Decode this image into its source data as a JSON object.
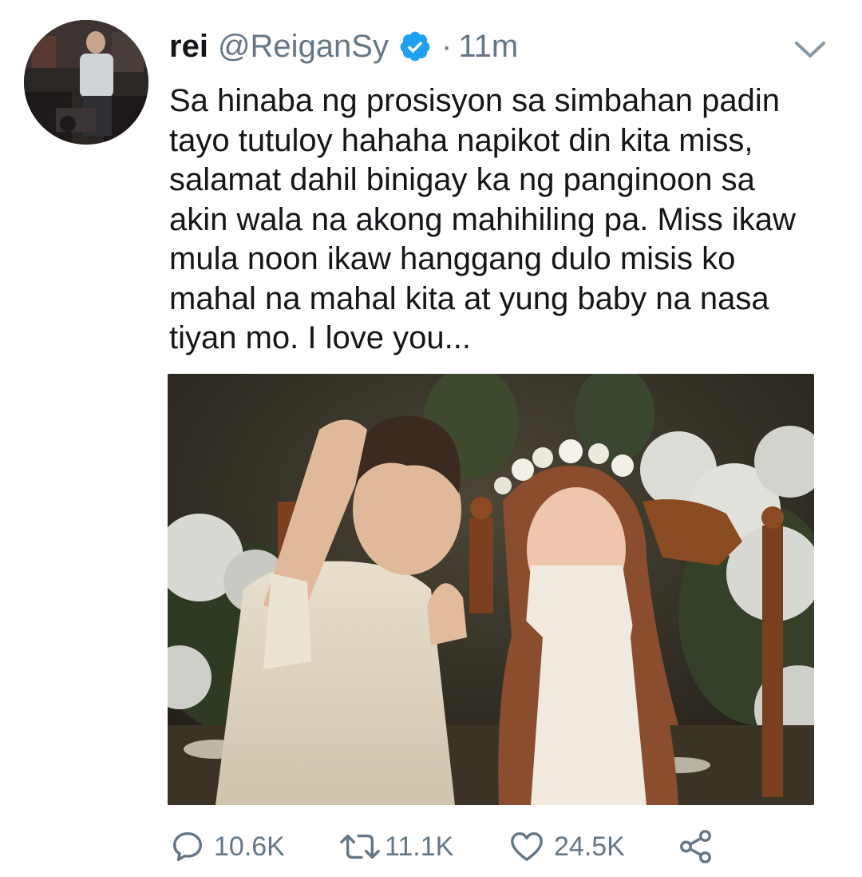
{
  "tweet": {
    "author": {
      "display_name": "rei",
      "handle": "@ReiganSy",
      "verified": true
    },
    "separator": "·",
    "time": "11m",
    "text": "Sa hinaba ng prosisyon sa simbahan padin\ntayo tutuloy hahaha napikot din kita miss,\nsalamat dahil binigay ka ng panginoon sa\nakin wala na akong mahihiling pa. Miss ikaw\nmula noon ikaw hanggang dulo misis ko\nmahal na mahal kita at yung baby na nasa\ntiyan mo. I love you...",
    "stats": {
      "replies": "10.6K",
      "retweets": "11.1K",
      "likes": "24.5K"
    }
  },
  "colors": {
    "text_primary": "#14171a",
    "text_secondary": "#657786",
    "verified_blue": "#1da1f2",
    "icon_gray": "#657786"
  },
  "icons": {
    "verified": "verified-badge-icon",
    "caret": "chevron-down-icon",
    "reply": "reply-icon",
    "retweet": "retweet-icon",
    "like": "heart-icon",
    "share": "share-icon"
  }
}
